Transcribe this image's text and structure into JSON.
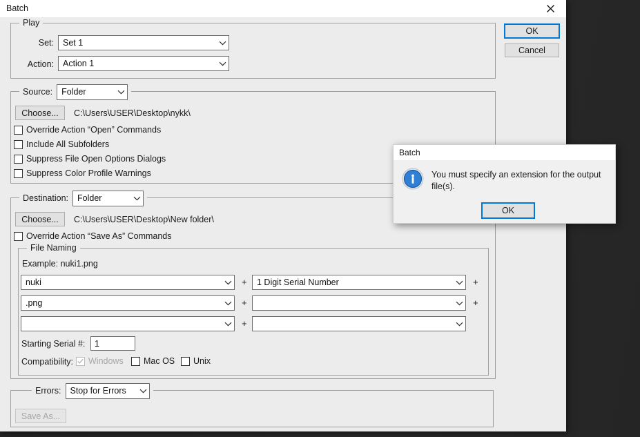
{
  "window": {
    "title": "Batch",
    "close_icon": "close-icon"
  },
  "buttons": {
    "ok": "OK",
    "cancel": "Cancel"
  },
  "play": {
    "legend": "Play",
    "set_label": "Set:",
    "set_value": "Set 1",
    "action_label": "Action:",
    "action_value": "Action 1"
  },
  "source": {
    "legend_label": "Source:",
    "legend_value": "Folder",
    "choose_button": "Choose...",
    "path": "C:\\Users\\USER\\Desktop\\nykk\\",
    "checkboxes": [
      {
        "label": "Override Action “Open” Commands",
        "checked": false
      },
      {
        "label": "Include All Subfolders",
        "checked": false
      },
      {
        "label": "Suppress File Open Options Dialogs",
        "checked": false
      },
      {
        "label": "Suppress Color Profile Warnings",
        "checked": false
      }
    ]
  },
  "destination": {
    "legend_label": "Destination:",
    "legend_value": "Folder",
    "choose_button": "Choose...",
    "path": "C:\\Users\\USER\\Desktop\\New folder\\",
    "override_saveas": {
      "label": "Override Action “Save As” Commands",
      "checked": false
    },
    "file_naming": {
      "legend": "File Naming",
      "example_label": "Example: nuki1.png",
      "rows": [
        {
          "left": "nuki",
          "right": "1 Digit Serial Number",
          "plus": "+",
          "right_plus": "+"
        },
        {
          "left": ".png",
          "right": "",
          "plus": "+",
          "right_plus": "+"
        },
        {
          "left": "",
          "right": "",
          "plus": "+",
          "right_plus": ""
        }
      ],
      "starting_serial_label": "Starting Serial #:",
      "starting_serial_value": "1",
      "compatibility_label": "Compatibility:",
      "compat": [
        {
          "label": "Windows",
          "checked": true,
          "disabled": true
        },
        {
          "label": "Mac OS",
          "checked": false,
          "disabled": false
        },
        {
          "label": "Unix",
          "checked": false,
          "disabled": false
        }
      ]
    }
  },
  "errors": {
    "legend_label": "Errors:",
    "legend_value": "Stop for Errors",
    "save_as_button": "Save As..."
  },
  "messagebox": {
    "title": "Batch",
    "icon": "info-icon",
    "text": "You must specify an extension for the output file(s).",
    "ok": "OK"
  },
  "colors": {
    "accent": "#0078d7",
    "dialog_bg": "#ececec",
    "info_blue": "#1f6fd0"
  }
}
